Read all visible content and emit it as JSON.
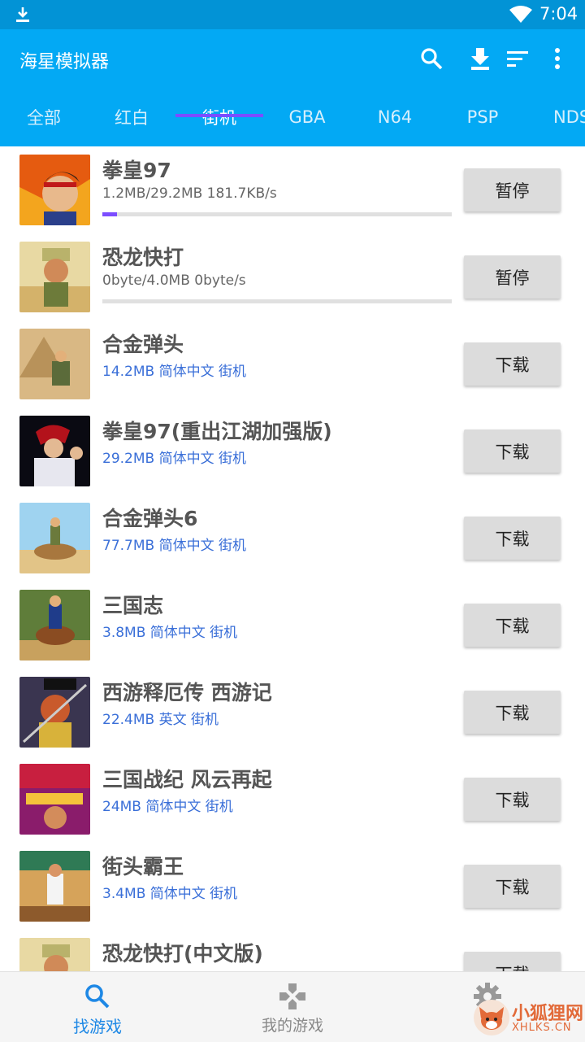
{
  "status_bar": {
    "time": "7:04"
  },
  "app_bar": {
    "title": "海星模拟器"
  },
  "tabs": [
    {
      "label": "全部"
    },
    {
      "label": "红白"
    },
    {
      "label": "街机",
      "active": true
    },
    {
      "label": "GBA"
    },
    {
      "label": "N64"
    },
    {
      "label": "PSP"
    },
    {
      "label": "NDS"
    }
  ],
  "games": [
    {
      "title": "拳皇97",
      "meta": "1.2MB/29.2MB  181.7KB/s",
      "downloading": true,
      "progress": 0.041,
      "button": "暂停"
    },
    {
      "title": "恐龙快打",
      "meta": "0byte/4.0MB  0byte/s",
      "downloading": true,
      "progress": 0,
      "button": "暂停"
    },
    {
      "title": "合金弹头",
      "meta": "14.2MB 简体中文 街机",
      "downloading": false,
      "button": "下载"
    },
    {
      "title": "拳皇97(重出江湖加强版)",
      "meta": "29.2MB 简体中文 街机",
      "downloading": false,
      "button": "下载"
    },
    {
      "title": "合金弹头6",
      "meta": "77.7MB 简体中文 街机",
      "downloading": false,
      "button": "下载"
    },
    {
      "title": "三国志",
      "meta": "3.8MB 简体中文 街机",
      "downloading": false,
      "button": "下载"
    },
    {
      "title": "西游释厄传 西游记",
      "meta": "22.4MB 英文 街机",
      "downloading": false,
      "button": "下载"
    },
    {
      "title": "三国战纪 风云再起",
      "meta": "24MB 简体中文 街机",
      "downloading": false,
      "button": "下载"
    },
    {
      "title": "街头霸王",
      "meta": "3.4MB 简体中文 街机",
      "downloading": false,
      "button": "下载"
    },
    {
      "title": "恐龙快打(中文版)",
      "meta": "",
      "downloading": false,
      "button": "下载"
    }
  ],
  "bottom_nav": [
    {
      "label": "找游戏",
      "icon": "search-icon",
      "active": true
    },
    {
      "label": "我的游戏",
      "icon": "gamepad-icon",
      "active": false
    },
    {
      "label": "",
      "icon": "gear-icon",
      "active": false
    }
  ],
  "watermark": {
    "text": "小狐狸网",
    "sub": "XHLKS.CN"
  },
  "colors": {
    "app_bar": "#03a9f4",
    "status_bar": "#0293d6",
    "accent": "#7c4dff",
    "meta_text": "#3a6fd8"
  }
}
